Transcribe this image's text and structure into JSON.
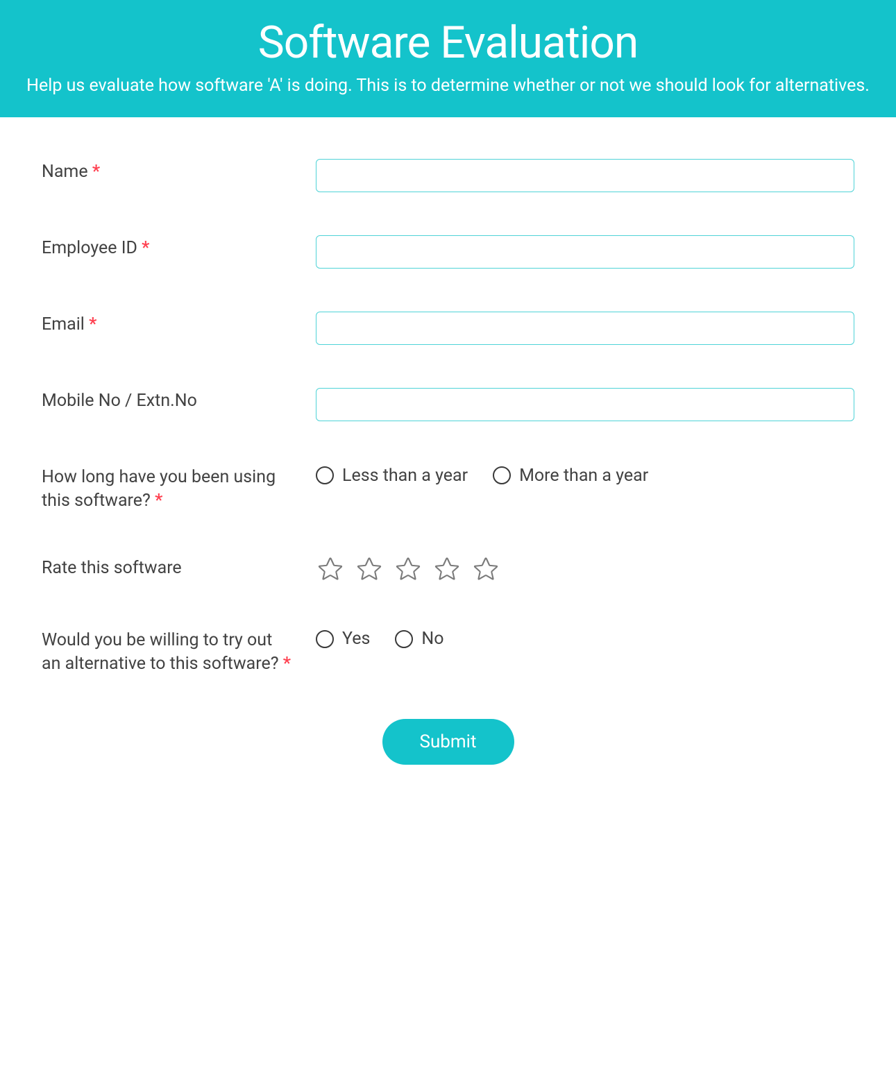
{
  "header": {
    "title": "Software Evaluation",
    "subtitle": "Help us evaluate how software 'A' is doing. This is to determine whether or not we should look for alternatives."
  },
  "fields": {
    "name": {
      "label": "Name",
      "required": true,
      "value": ""
    },
    "employee_id": {
      "label": "Employee ID",
      "required": true,
      "value": ""
    },
    "email": {
      "label": "Email",
      "required": true,
      "value": ""
    },
    "mobile": {
      "label": "Mobile No / Extn.No",
      "required": false,
      "value": ""
    },
    "duration": {
      "label": "How long have you been using this software?",
      "required": true,
      "options": [
        "Less than a year",
        "More than a year"
      ]
    },
    "rating": {
      "label": "Rate this software",
      "required": false,
      "star_count": 5
    },
    "alternative": {
      "label": "Would you be willing to try out an alternative to this software?",
      "required": true,
      "options": [
        "Yes",
        "No"
      ]
    }
  },
  "submit": {
    "label": "Submit"
  },
  "required_marker": "*"
}
